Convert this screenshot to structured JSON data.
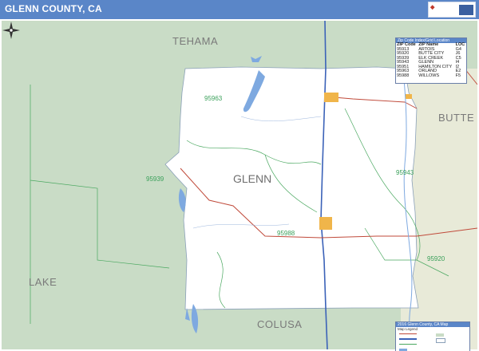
{
  "title": "GLENN COUNTY, CA",
  "map": {
    "county_label": "GLENN",
    "neighbors": [
      "TEHAMA",
      "BUTTE",
      "COLUSA",
      "LAKE"
    ],
    "zip_labels": [
      "95963",
      "95939",
      "95943",
      "95988",
      "95920"
    ],
    "colors": {
      "header": "#5a86c8",
      "county_fill": "#ffffff",
      "outside_fill": "#c9dcc6",
      "east_fill": "#e8ead8",
      "water": "#7ea9e0",
      "roads": "#c04a3a",
      "zip_lines": "#4aa860",
      "highway": "#3b62b8"
    }
  },
  "zip_table": {
    "title": "Zip Code Index/Grid Location",
    "headers": [
      "ZIP Code",
      "ZIP Name",
      "LOC"
    ],
    "rows": [
      [
        "95913",
        "ARTOIS",
        "G4"
      ],
      [
        "95920",
        "BUTTE CITY",
        "J6"
      ],
      [
        "95939",
        "ELK CREEK",
        "C5"
      ],
      [
        "95943",
        "GLENN",
        "I4"
      ],
      [
        "95951",
        "HAMILTON CITY",
        "I2"
      ],
      [
        "95963",
        "ORLAND",
        "E2"
      ],
      [
        "95988",
        "WILLOWS",
        "F5"
      ]
    ]
  },
  "legend": {
    "title": "2016 Glenn County, CA Map",
    "subtitle": "Map Legend"
  }
}
